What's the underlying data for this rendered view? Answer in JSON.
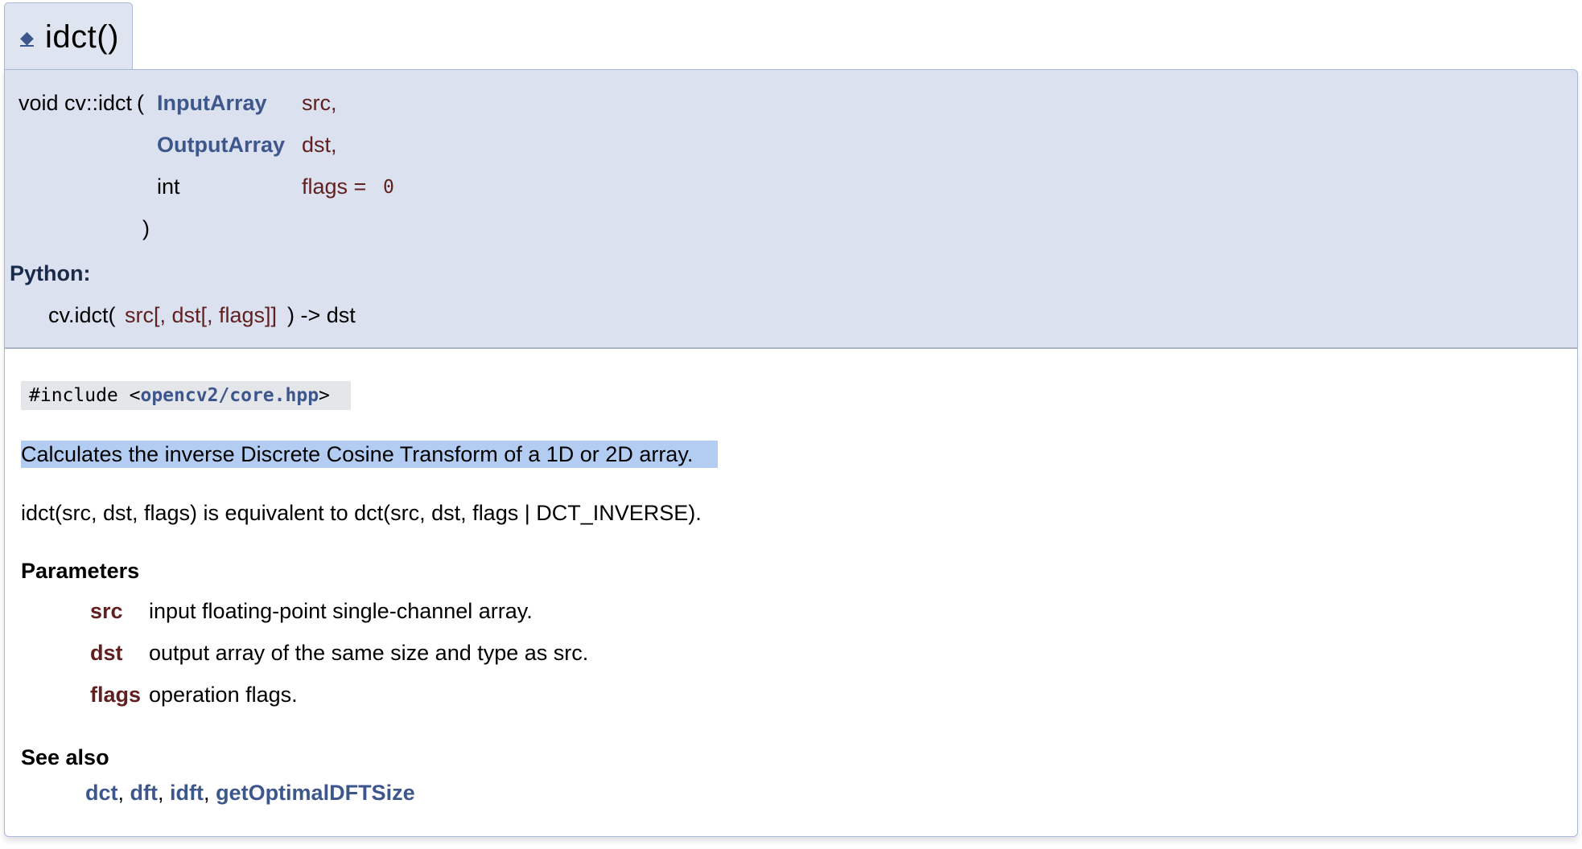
{
  "member": {
    "anchor_glyph": "◆",
    "name": "idct()"
  },
  "prototype": {
    "return_type_and_name": "void cv::idct",
    "open_paren": "(",
    "close_paren": ")",
    "params": [
      {
        "type": "InputArray",
        "name": "src,",
        "default": ""
      },
      {
        "type": "OutputArray",
        "name": "dst,",
        "default": ""
      },
      {
        "type": "int",
        "name": "flags = ",
        "default": "0"
      }
    ]
  },
  "python": {
    "label": "Python:",
    "func": "cv.idct(",
    "args": "src[, dst[, flags]]",
    "ret": ") -> dst"
  },
  "include": {
    "prefix": "#include <",
    "file": "opencv2/core.hpp",
    "suffix": ">"
  },
  "brief": "Calculates the inverse Discrete Cosine Transform of a 1D or 2D array.",
  "details": "idct(src, dst, flags) is equivalent to dct(src, dst, flags | DCT_INVERSE).",
  "parameters": {
    "heading": "Parameters",
    "items": [
      {
        "name": "src",
        "desc": "input floating-point single-channel array."
      },
      {
        "name": "dst",
        "desc": "output array of the same size and type as src."
      },
      {
        "name": "flags",
        "desc": "operation flags."
      }
    ]
  },
  "see_also": {
    "heading": "See also",
    "links": [
      "dct",
      "dft",
      "idft",
      "getOptimalDFTSize"
    ],
    "separator": ","
  },
  "colors": {
    "link": "#3d578c",
    "param": "#602020",
    "proto_bg": "#dbe1ef",
    "border": "#a8b8d9",
    "highlight": "#b3cdf2"
  }
}
